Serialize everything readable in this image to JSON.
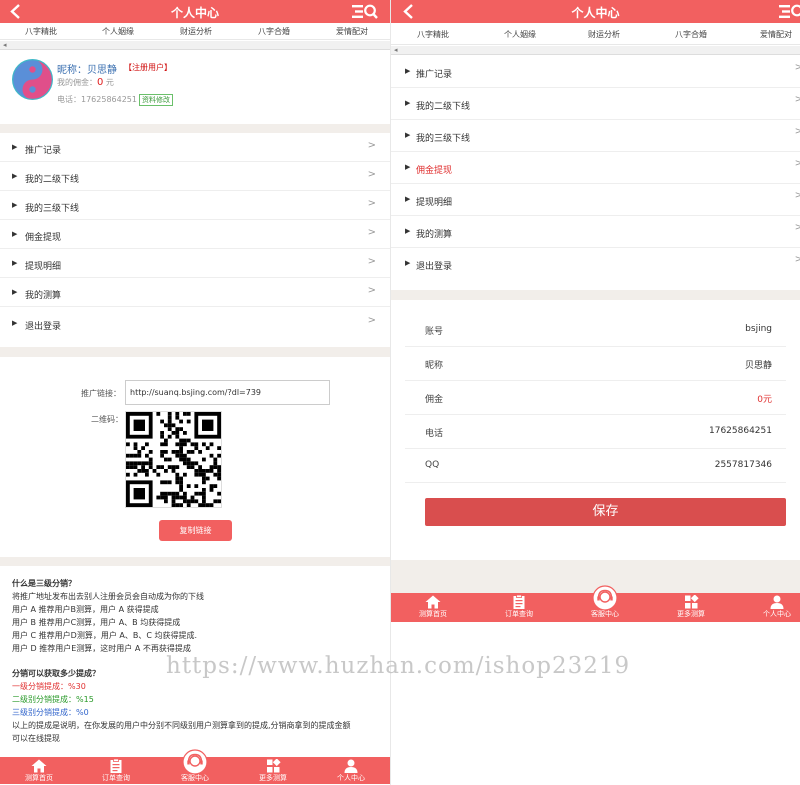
{
  "header": {
    "title": "个人中心"
  },
  "category_nav": [
    "八字精批",
    "个人姻缘",
    "财运分析",
    "八字合婚",
    "爱情配对"
  ],
  "profile": {
    "nickname_label": "昵称：",
    "nickname": "贝思静",
    "user_tag": "【注册用户】",
    "commission_label": "我的佣金：",
    "commission_value": "0",
    "commission_unit": "元",
    "phone_label": "电话：",
    "phone": "17625864251",
    "edit_label": "资料修改"
  },
  "menu": [
    {
      "label": "推广记录"
    },
    {
      "label": "我的二级下线"
    },
    {
      "label": "我的三级下线"
    },
    {
      "label": "佣金提现"
    },
    {
      "label": "提现明细"
    },
    {
      "label": "我的测算"
    },
    {
      "label": "退出登录"
    }
  ],
  "menu_chevron": ">",
  "menu_bullet": "▶",
  "promo": {
    "link_label": "推广链接：",
    "link_value": "http://suanq.bsjing.com/?dl=739",
    "qr_label": "二维码：",
    "copy_button": "复制链接"
  },
  "explain": {
    "q1": "什么是三级分销？",
    "lines1": [
      "将推广地址发布出去别人注册会员会自动成为你的下线",
      "用户 A 推荐用户B测算，用户 A 获得提成",
      "用户 B 推荐用户C测算，用户 A、B 均获得提成",
      "用户 C 推荐用户D测算，用户 A、B、C 均获得提成.",
      "用户 D 推荐用户E测算，这时用户 A 不再获得提成"
    ],
    "q2": "分销可以获取多少提成？",
    "level1": "一级分销提成：%30",
    "level2": "二级别分销提成：%15",
    "level3": "三级别分销提成：%0",
    "note1": "以上的提成是说明，在你发展的用户中分别不同级别用户测算拿到的提成,分销商拿到的提成金额",
    "note2": "可以在线提现"
  },
  "watermark": "https://www.huzhan.com/ishop23219",
  "tabbar": [
    "测算首页",
    "订单查询",
    "客服中心",
    "更多测算",
    "个人中心"
  ],
  "right_menu_highlight_index": 3,
  "account_info": [
    {
      "key": "账号",
      "value": "bsjing"
    },
    {
      "key": "昵称",
      "value": "贝思静"
    },
    {
      "key": "佣金",
      "value": "0元"
    },
    {
      "key": "电话",
      "value": "17625864251"
    },
    {
      "key": "QQ",
      "value": "2557817346"
    }
  ],
  "save_button": "保存",
  "colors": {
    "brand": "#f26060",
    "accent_red": "#e03030",
    "section_gap": "#f2eeea"
  }
}
